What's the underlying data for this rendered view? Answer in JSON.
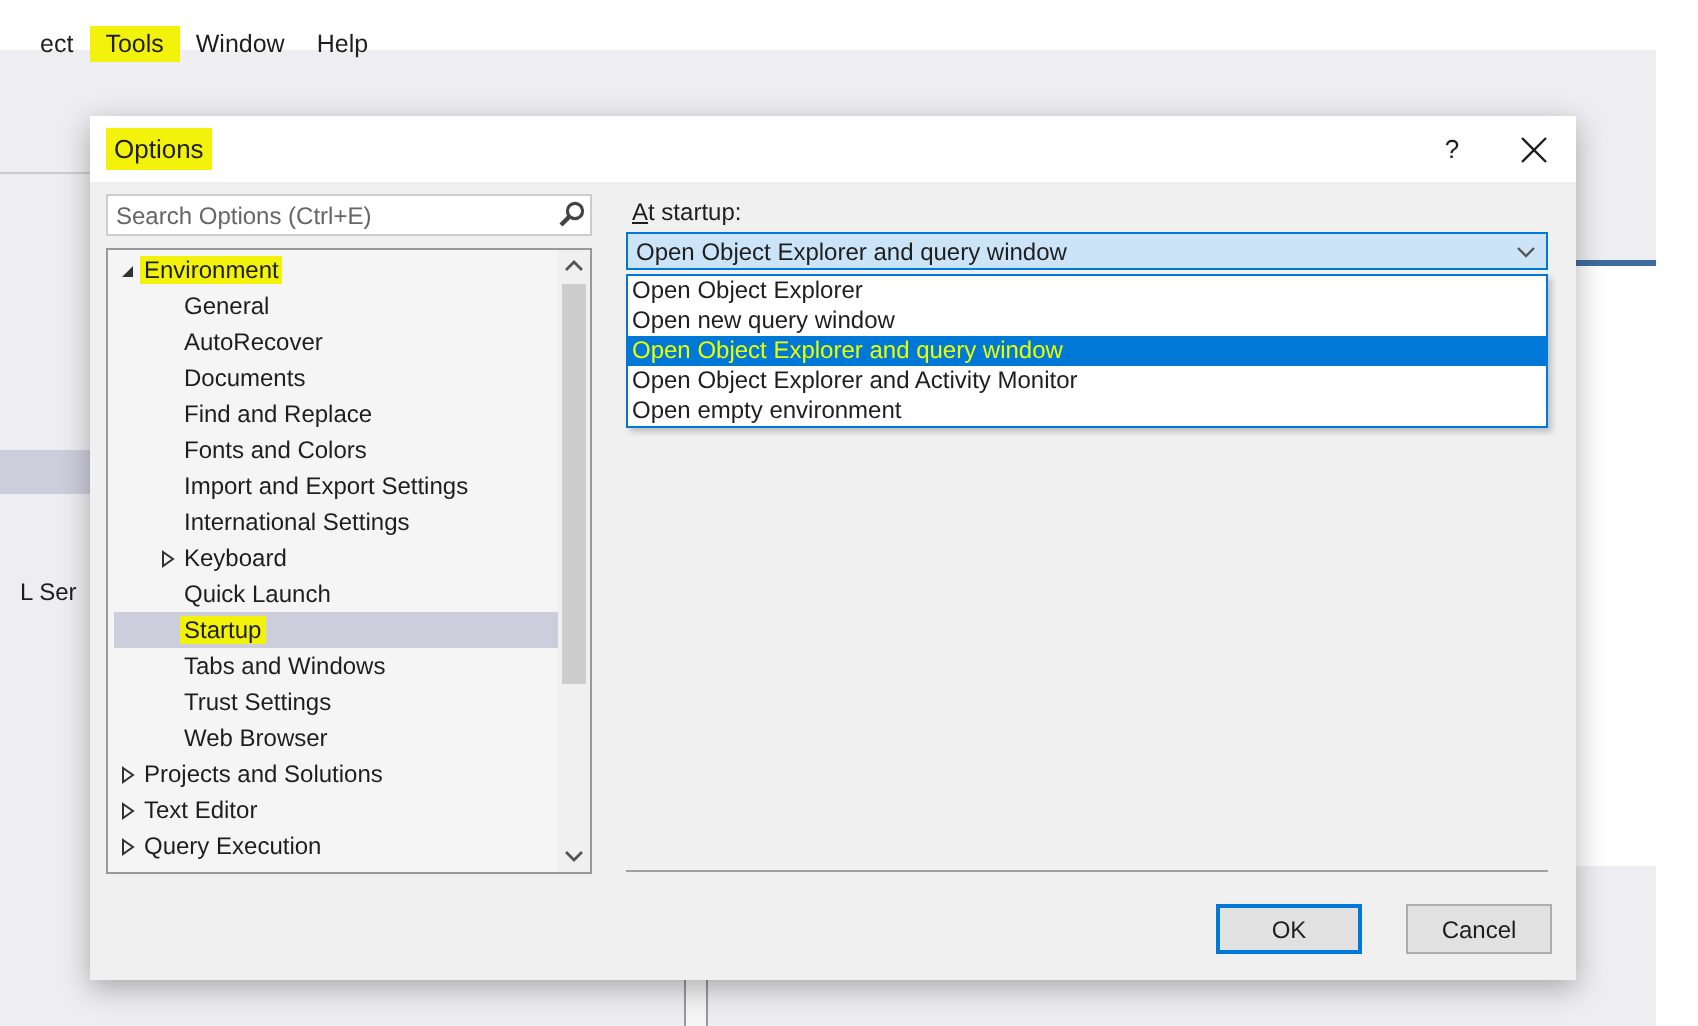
{
  "app": {
    "menu": [
      {
        "label": "ect",
        "highlighted": false
      },
      {
        "label": "Tools",
        "highlighted": true
      },
      {
        "label": "Window",
        "highlighted": false
      },
      {
        "label": "Help",
        "highlighted": false
      }
    ],
    "side_text": "L Ser"
  },
  "dialog": {
    "title": "Options",
    "title_highlighted": true,
    "help": "?",
    "search": {
      "placeholder": "Search Options (Ctrl+E)"
    },
    "tree": [
      {
        "label": "Environment",
        "expandable": true,
        "expanded": true,
        "selected": false,
        "highlighted": true,
        "children": [
          {
            "label": "General",
            "expandable": false,
            "selected": false,
            "highlighted": false
          },
          {
            "label": "AutoRecover",
            "expandable": false,
            "selected": false,
            "highlighted": false
          },
          {
            "label": "Documents",
            "expandable": false,
            "selected": false,
            "highlighted": false
          },
          {
            "label": "Find and Replace",
            "expandable": false,
            "selected": false,
            "highlighted": false
          },
          {
            "label": "Fonts and Colors",
            "expandable": false,
            "selected": false,
            "highlighted": false
          },
          {
            "label": "Import and Export Settings",
            "expandable": false,
            "selected": false,
            "highlighted": false
          },
          {
            "label": "International Settings",
            "expandable": false,
            "selected": false,
            "highlighted": false
          },
          {
            "label": "Keyboard",
            "expandable": true,
            "expanded": false,
            "selected": false,
            "highlighted": false
          },
          {
            "label": "Quick Launch",
            "expandable": false,
            "selected": false,
            "highlighted": false
          },
          {
            "label": "Startup",
            "expandable": false,
            "selected": true,
            "highlighted": true
          },
          {
            "label": "Tabs and Windows",
            "expandable": false,
            "selected": false,
            "highlighted": false
          },
          {
            "label": "Trust Settings",
            "expandable": false,
            "selected": false,
            "highlighted": false
          },
          {
            "label": "Web Browser",
            "expandable": false,
            "selected": false,
            "highlighted": false
          }
        ]
      },
      {
        "label": "Projects and Solutions",
        "expandable": true,
        "expanded": false,
        "selected": false,
        "highlighted": false
      },
      {
        "label": "Text Editor",
        "expandable": true,
        "expanded": false,
        "selected": false,
        "highlighted": false
      },
      {
        "label": "Query Execution",
        "expandable": true,
        "expanded": false,
        "selected": false,
        "highlighted": false
      }
    ],
    "startup_label": "At startup:",
    "combo": {
      "value": "Open Object Explorer and query window",
      "expanded": true
    },
    "options": [
      {
        "label": "Open Object Explorer",
        "selected": false,
        "highlighted": false
      },
      {
        "label": "Open new query window",
        "selected": false,
        "highlighted": false
      },
      {
        "label": "Open Object Explorer and query window",
        "selected": true,
        "highlighted": true
      },
      {
        "label": "Open Object Explorer and Activity Monitor",
        "selected": false,
        "highlighted": false
      },
      {
        "label": "Open empty environment",
        "selected": false,
        "highlighted": false
      }
    ],
    "buttons": [
      {
        "label": "OK",
        "default": true
      },
      {
        "label": "Cancel",
        "default": false
      }
    ]
  }
}
